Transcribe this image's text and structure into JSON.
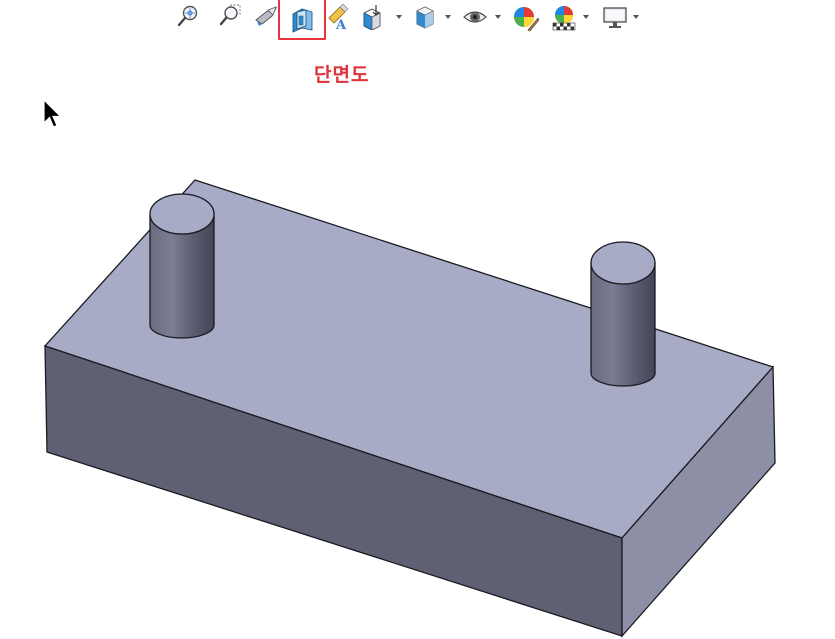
{
  "toolbar": {
    "items": [
      {
        "icon": "zoom-to-fit-icon"
      },
      {
        "icon": "zoom-to-area-icon"
      },
      {
        "icon": "previous-view-icon"
      },
      {
        "icon": "section-view-icon",
        "highlighted": true
      },
      {
        "icon": "dynamic-annotation-views-icon"
      },
      {
        "icon": "view-orientation-icon",
        "has_dropdown": true
      },
      {
        "icon": "display-style-icon",
        "has_dropdown": true
      },
      {
        "icon": "hide-show-items-icon",
        "has_dropdown": true
      },
      {
        "icon": "edit-appearance-icon"
      },
      {
        "icon": "apply-scene-icon",
        "has_dropdown": true
      },
      {
        "icon": "view-settings-icon",
        "has_dropdown": true
      }
    ]
  },
  "callout": {
    "label": "단면도",
    "color": "#e0303a"
  },
  "model": {
    "face_colors": {
      "top": "#a8abc6",
      "front": "#5f6073",
      "side": "#8d8fa6",
      "back_edge": "#c5c7d8",
      "edge": "#1a1a22"
    }
  }
}
